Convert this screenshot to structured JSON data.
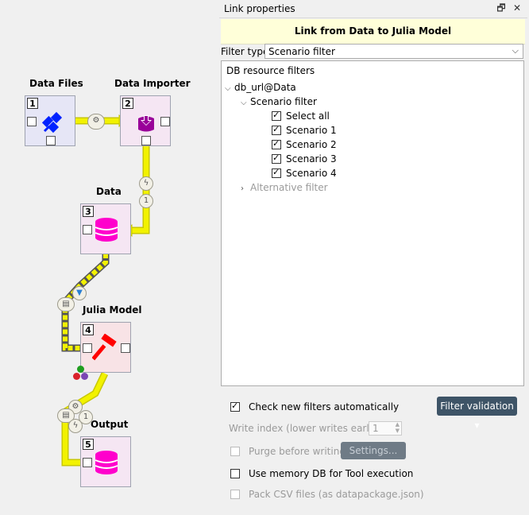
{
  "design": {
    "nodes": [
      {
        "id": "data-files",
        "title": "Data Files",
        "number": "1",
        "icon": "satellite-icon"
      },
      {
        "id": "data-importer",
        "title": "Data Importer",
        "number": "2",
        "icon": "import-icon"
      },
      {
        "id": "data",
        "title": "Data",
        "number": "3",
        "icon": "database-icon"
      },
      {
        "id": "julia-model",
        "title": "Julia Model",
        "number": "4",
        "icon": "hammer-icon"
      },
      {
        "id": "output",
        "title": "Output",
        "number": "5",
        "icon": "database-icon"
      }
    ],
    "badges": {
      "importer_in": "⚙",
      "data_in_top": "ϟ",
      "data_in_bottom": "1",
      "julia_filter": "▼",
      "julia_pack": "▤",
      "output_gear": "⚙",
      "output_pack": "▤",
      "output_bolt": "ϟ",
      "output_one": "1"
    },
    "colors": {
      "link": "#f2f200",
      "link_border": "#c8c800",
      "dc_node": "#e6e6f6",
      "tool_node": "#f8e3e6",
      "db_node": "#f5e6f3",
      "db_icon": "#ff00cc",
      "hammer": "#ff0000",
      "satellite": "#0022ff",
      "importer": "#990099"
    }
  },
  "panel": {
    "title": "Link properties",
    "float_icon": "🗗",
    "close_icon": "✕",
    "banner": "Link from Data to Julia Model",
    "filter_type_label": "Filter type:",
    "filter_type_value": "Scenario filter",
    "tree": {
      "header": "DB resource filters",
      "db_url": "db_url@Data",
      "scenario_filter": "Scenario filter",
      "items": [
        {
          "label": "Select all",
          "checked": true
        },
        {
          "label": "Scenario 1",
          "checked": true
        },
        {
          "label": "Scenario 2",
          "checked": true
        },
        {
          "label": "Scenario 3",
          "checked": true
        },
        {
          "label": "Scenario 4",
          "checked": true
        }
      ],
      "alternative_filter": "Alternative filter"
    },
    "options": {
      "check_new_filters": "Check new filters automatically",
      "filter_validation": "Filter validation",
      "write_index_label": "Write index (lower writes earlier):",
      "write_index_value": "1",
      "purge_before_writing": "Purge before writing",
      "settings": "Settings...",
      "use_memory_db": "Use memory DB for Tool execution",
      "pack_csv": "Pack CSV files (as datapackage.json)"
    }
  }
}
